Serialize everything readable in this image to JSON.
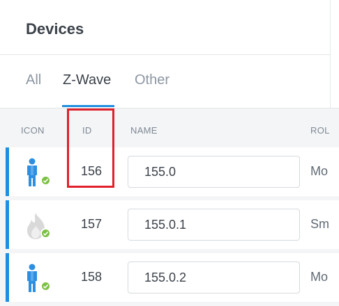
{
  "header": {
    "title": "Devices"
  },
  "tabs": [
    {
      "label": "All",
      "active": false
    },
    {
      "label": "Z-Wave",
      "active": true
    },
    {
      "label": "Other",
      "active": false
    }
  ],
  "table": {
    "columns": [
      "ICON",
      "ID",
      "NAME",
      "ROL"
    ],
    "rows": [
      {
        "icon": "person-icon",
        "status": "online",
        "id": "156",
        "name": "155.0",
        "role": "Mo"
      },
      {
        "icon": "fire-icon",
        "status": "online",
        "id": "157",
        "name": "155.0.1",
        "role": "Sm"
      },
      {
        "icon": "person-icon",
        "status": "online",
        "id": "158",
        "name": "155.0.2",
        "role": "Mo"
      }
    ]
  },
  "colors": {
    "accent": "#1f8ee0",
    "status_ok": "#7cc142",
    "highlight": "#e0202a"
  }
}
